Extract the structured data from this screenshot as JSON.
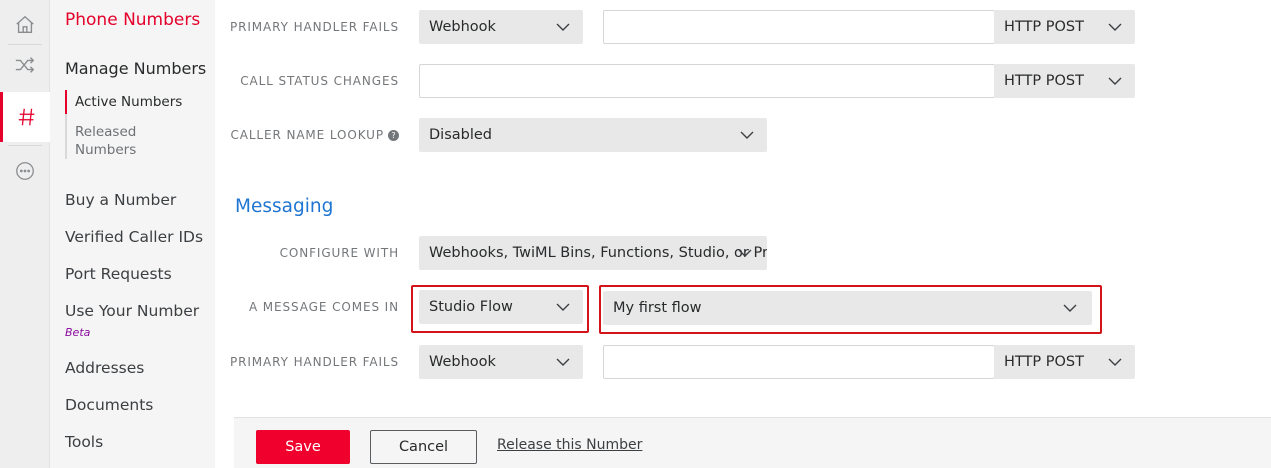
{
  "rail": {
    "icons": [
      "home-icon",
      "shuffle-icon",
      "hash-icon",
      "more-icon"
    ],
    "accent": "#e4002b"
  },
  "sidebar": {
    "title": "Phone Numbers",
    "section": "Manage Numbers",
    "sub_items": [
      "Active Numbers",
      "Released Numbers"
    ],
    "links": [
      "Buy a Number",
      "Verified Caller IDs",
      "Port Requests",
      "Use Your Number",
      "Addresses",
      "Documents",
      "Tools"
    ],
    "beta_badge": "Beta"
  },
  "voice": {
    "primary_handler_fails": {
      "label": "PRIMARY HANDLER FAILS",
      "type": "Webhook",
      "url": "",
      "method": "HTTP POST"
    },
    "call_status_changes": {
      "label": "CALL STATUS CHANGES",
      "url": "",
      "method": "HTTP POST"
    },
    "caller_name_lookup": {
      "label": "CALLER NAME LOOKUP",
      "value": "Disabled",
      "help_glyph": "?"
    }
  },
  "messaging": {
    "title": "Messaging",
    "configure_with": {
      "label": "CONFIGURE WITH",
      "value": "Webhooks, TwiML Bins, Functions, Studio, or Proxy"
    },
    "message_comes_in": {
      "label": "A MESSAGE COMES IN",
      "type": "Studio Flow",
      "flow": "My first flow"
    },
    "primary_handler_fails": {
      "label": "PRIMARY HANDLER FAILS",
      "type": "Webhook",
      "url": "",
      "method": "HTTP POST"
    }
  },
  "footer": {
    "save_label": "Save",
    "cancel_label": "Cancel",
    "release_label": "Release this Number"
  },
  "colors": {
    "accent_red": "#e4002b",
    "highlight": "#d3141a",
    "link_blue": "#1f75d2"
  }
}
